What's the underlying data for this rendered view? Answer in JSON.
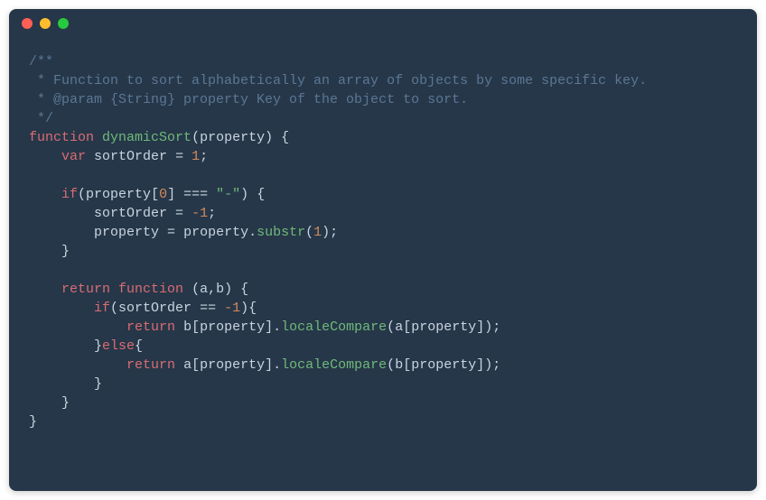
{
  "window": {
    "dots": {
      "red": "close",
      "yellow": "minimize",
      "green": "maximize"
    }
  },
  "code": {
    "comment_open": "/**",
    "comment_line1": " * Function to sort alphabetically an array of objects by some specific key.",
    "comment_line2": " * @param {String} property Key of the object to sort.",
    "comment_close": " */",
    "kw_function": "function",
    "fn_name": "dynamicSort",
    "param_property": "property",
    "kw_var": "var",
    "var_sortOrder": "sortOrder",
    "num_1": "1",
    "num_0": "0",
    "num_neg1": "-1",
    "kw_if": "if",
    "kw_else": "else",
    "kw_return": "return",
    "str_dash": "\"-\"",
    "op_eq3": "===",
    "op_eq2": "==",
    "op_assign": "=",
    "method_substr": "substr",
    "method_localeCompare": "localeCompare",
    "param_a": "a",
    "param_b": "b",
    "brace_open": "{",
    "brace_close": "}",
    "paren_open": "(",
    "paren_close": ")",
    "semicolon": ";",
    "comma": ",",
    "dot": ".",
    "bracket_open": "[",
    "bracket_close": "]"
  }
}
